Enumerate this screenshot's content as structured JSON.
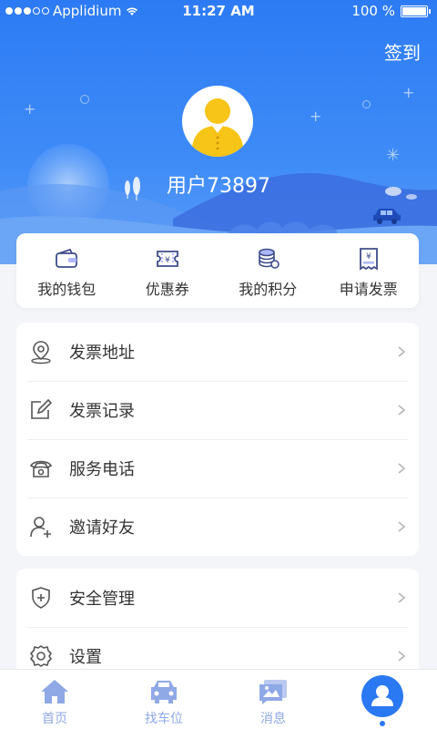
{
  "status_bar": {
    "carrier": "Applidium",
    "time": "11:27 AM",
    "battery": "100 %"
  },
  "header": {
    "signin_label": "签到",
    "username": "用户73897"
  },
  "quick_actions": [
    {
      "label": "我的钱包",
      "icon": "wallet-icon"
    },
    {
      "label": "优惠券",
      "icon": "coupon-icon"
    },
    {
      "label": "我的积分",
      "icon": "coins-icon"
    },
    {
      "label": "申请发票",
      "icon": "invoice-icon"
    }
  ],
  "menu_group_1": [
    {
      "label": "发票地址",
      "icon": "location-pin-icon"
    },
    {
      "label": "发票记录",
      "icon": "edit-icon"
    },
    {
      "label": "服务电话",
      "icon": "phone-icon"
    },
    {
      "label": "邀请好友",
      "icon": "add-user-icon"
    }
  ],
  "menu_group_2": [
    {
      "label": "安全管理",
      "icon": "shield-icon"
    },
    {
      "label": "设置",
      "icon": "gear-icon"
    }
  ],
  "tabbar": [
    {
      "label": "首页",
      "icon": "home-icon"
    },
    {
      "label": "找车位",
      "icon": "car-icon"
    },
    {
      "label": "消息",
      "icon": "message-icon"
    },
    {
      "label": "",
      "icon": "user-icon",
      "active": true
    }
  ],
  "colors": {
    "primary": "#2a78f2",
    "header_top": "#2d7bf4",
    "tab_inactive": "#8fa8e6",
    "avatar_yellow": "#f7c418"
  }
}
